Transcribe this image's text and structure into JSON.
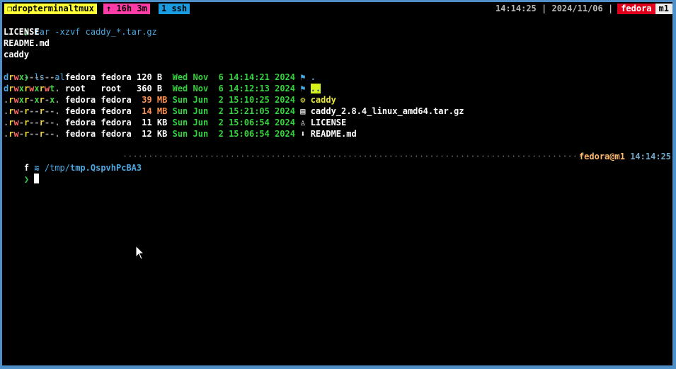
{
  "statusbar": {
    "session_icon": "❐",
    "session_name": "dropterminaltmux",
    "uptime": "↑ 16h 3m",
    "window": "1 ssh",
    "time": "14:14:25",
    "sep": "|",
    "date": "2024/11/06",
    "user": "fedora",
    "host": "m1"
  },
  "terminal": {
    "prompt_char": "❯",
    "cmd1": "tar -xzvf caddy_*.tar.gz",
    "extract_out": [
      "LICENSE",
      "README.md",
      "caddy"
    ],
    "cmd2": "ls -al",
    "ls_rows": [
      {
        "perm": "drwx------.",
        "user": "fedora",
        "group": "fedora",
        "size": "120",
        "unit": "B",
        "date": "Wed Nov  6 14:14:21 2024",
        "icon": "⚑",
        "name": "."
      },
      {
        "perm": "drwxrwxrwt.",
        "user": "root",
        "group": "root",
        "size": "360",
        "unit": "B",
        "date": "Wed Nov  6 14:12:13 2024",
        "icon": "⚑",
        "name": ".."
      },
      {
        "perm": ".rwxr-xr-x.",
        "user": "fedora",
        "group": "fedora",
        "size": "39",
        "unit": "MB",
        "date": "Sun Jun  2 15:10:25 2024",
        "icon": "⚙",
        "name": "caddy"
      },
      {
        "perm": ".rw-r--r--.",
        "user": "fedora",
        "group": "fedora",
        "size": "14",
        "unit": "MB",
        "date": "Sun Jun  2 15:21:05 2024",
        "icon": "▤",
        "name": "caddy_2.8.4_linux_amd64.tar.gz"
      },
      {
        "perm": ".rw-r--r--.",
        "user": "fedora",
        "group": "fedora",
        "size": "11",
        "unit": "KB",
        "date": "Sun Jun  2 15:06:54 2024",
        "icon": "♙",
        "name": "LICENSE"
      },
      {
        "perm": ".rw-r--r--.",
        "user": "fedora",
        "group": "fedora",
        "size": "12",
        "unit": "KB",
        "date": "Sun Jun  2 15:06:54 2024",
        "icon": "⬇",
        "name": "README.md"
      }
    ],
    "prompt_os_icon": "f",
    "prompt_folder_icon": "≋",
    "prompt_path_prefix": "/tmp/",
    "prompt_path_dir": "tmp.QspvhPcBA3",
    "prompt_user_host": "fedora@m1",
    "prompt_time": "14:14:25"
  }
}
